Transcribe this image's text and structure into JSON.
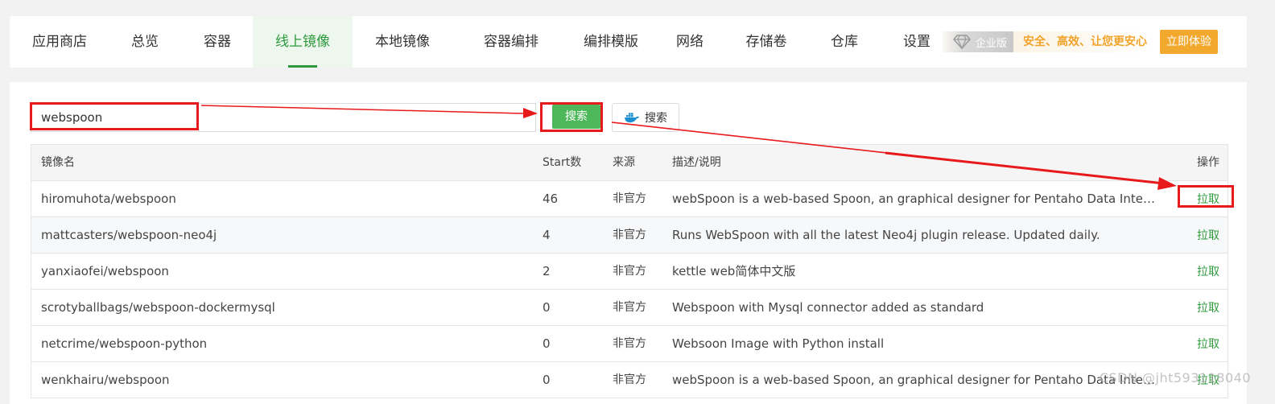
{
  "nav": {
    "items": [
      {
        "label": "应用商店",
        "active": false
      },
      {
        "label": "总览",
        "active": false
      },
      {
        "label": "容器",
        "active": false
      },
      {
        "label": "线上镜像",
        "active": true
      },
      {
        "label": "本地镜像",
        "active": false
      },
      {
        "label": "容器编排",
        "active": false
      },
      {
        "label": "编排模版",
        "active": false
      },
      {
        "label": "网络",
        "active": false
      },
      {
        "label": "存储卷",
        "active": false
      },
      {
        "label": "仓库",
        "active": false
      },
      {
        "label": "设置",
        "active": false
      }
    ],
    "enterprise_label": "企业版",
    "promo_text": "安全、高效、让您更安心",
    "try_button": "立即体验"
  },
  "search": {
    "value": "webspoon",
    "button_label": "搜索",
    "docker_button_label": "搜索"
  },
  "table": {
    "headers": {
      "name": "镜像名",
      "stars": "Start数",
      "source": "来源",
      "desc": "描述/说明",
      "op": "操作"
    },
    "rows": [
      {
        "name": "hiromuhota/webspoon",
        "stars": "46",
        "source": "非官方",
        "desc": "webSpoon is a web-based Spoon, an graphical designer for Pentaho Data Integrati...",
        "op": "拉取"
      },
      {
        "name": "mattcasters/webspoon-neo4j",
        "stars": "4",
        "source": "非官方",
        "desc": "Runs WebSpoon with all the latest Neo4j plugin release. Updated daily.",
        "op": "拉取"
      },
      {
        "name": "yanxiaofei/webspoon",
        "stars": "2",
        "source": "非官方",
        "desc": "kettle web简体中文版",
        "op": "拉取"
      },
      {
        "name": "scrotyballbags/webspoon-dockermysql",
        "stars": "0",
        "source": "非官方",
        "desc": "Webspoon with Mysql connector added as standard",
        "op": "拉取"
      },
      {
        "name": "netcrime/webspoon-python",
        "stars": "0",
        "source": "非官方",
        "desc": "Websoon Image with Python install",
        "op": "拉取"
      },
      {
        "name": "wenkhairu/webspoon",
        "stars": "0",
        "source": "非官方",
        "desc": "webSpoon is a web-based Spoon, an graphical designer for Pentaho Data Integrati...",
        "op": "拉取"
      }
    ]
  },
  "watermark": "CSDN @jht593118040",
  "colors": {
    "accent": "#2e9a3c",
    "button_green": "#4cb85a",
    "annotation_red": "#e8191b",
    "promo_orange": "#f2a82c"
  }
}
